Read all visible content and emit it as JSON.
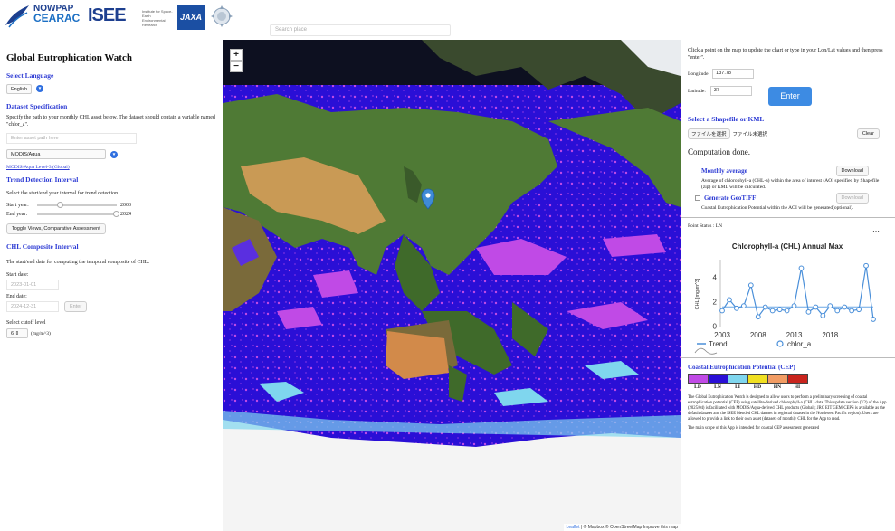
{
  "header": {
    "nowpap_line1": "NOWPAP",
    "nowpap_line2": "CEARAC",
    "isee_logo": "ISEE",
    "isee_sub": "Institute for Space-Earth Environmental Research",
    "jaxa_logo": "JAXA",
    "search_placeholder": "Search place"
  },
  "left_panel": {
    "title": "Global Eutrophication Watch",
    "select_language_heading": "Select Language",
    "language_value": "English",
    "dataset_heading": "Dataset Specification",
    "dataset_text": "Specify the path to your monthly CHL asset below. The dataset should contain a variable named \"chlor_a\".",
    "asset_placeholder": "Enter asset path here",
    "sensor_value": "MODIS/Aqua",
    "sensor_link": "MODIS/Aqua Level-3 (Global)",
    "trend_heading": "Trend Detection Interval",
    "trend_text": "Select the start/end year interval for trend detection.",
    "start_year_label": "Start year:",
    "start_year_value": "2003",
    "end_year_label": "End year:",
    "end_year_value": "2024",
    "toggle_button": "Toggle Views, Comparative Assessment",
    "composite_heading": "CHL Composite Interval",
    "composite_text": "The start/end date for computing the temporal composite of CHL.",
    "start_date_label": "Start date:",
    "start_date_value": "2023-01-01",
    "end_date_label": "End date:",
    "end_date_value": "2024-12-31",
    "enter_small": "Enter",
    "cutoff_label": "Select cutoff level",
    "cutoff_value": "6",
    "cutoff_unit": "(mg/m^3)"
  },
  "map": {
    "zoom_in": "+",
    "zoom_out": "−",
    "attribution_leaflet": "Leaflet",
    "attribution_rest": " | © Mapbox © OpenStreetMap Improve this map",
    "colors": {
      "ocean_ln": "#2a0fd6",
      "ld": "#c04ae6",
      "li": "#7fd6ee",
      "land": "#4f7a35",
      "desert": "#c99a55",
      "ice": "#f4f4f4"
    }
  },
  "right_panel": {
    "instruction": "Click a point on the map to update the chart or type in your Lon/Lat values and then press \"enter\".",
    "longitude_label": "Longitude:",
    "longitude_value": "137.78",
    "latitude_label": "Latitude:",
    "latitude_value": "37",
    "enter_button": "Enter",
    "shapefile_heading": "Select a Shapefile or KML",
    "file_button": "ファイルを選択",
    "file_status": "ファイル未選択",
    "clear_button": "Clear",
    "computation_status": "Computation done.",
    "monthly_avg_label": "Monthly average",
    "download_button": "Download",
    "monthly_avg_text": "Average of chlorophyll-a (CHL-a) within the area of interest (AOI specified by Shapefile (zip) or KML will be calculated.",
    "geotiff_label": "Generate GeoTIFF",
    "geotiff_download": "Download",
    "geotiff_text": "Coastal Eutrophication Potential within the AOI will be generated(optional).",
    "point_status": "Point Status : LN",
    "chart_menu": "⋯",
    "cep_heading": "Coastal Eutrophication Potential (CEP)",
    "cep_legend": [
      {
        "code": "LD",
        "color": "#c04ae6"
      },
      {
        "code": "LN",
        "color": "#2a0fd6"
      },
      {
        "code": "LI",
        "color": "#7fd6ee"
      },
      {
        "code": "HD",
        "color": "#f1e021"
      },
      {
        "code": "HN",
        "color": "#f29c63"
      },
      {
        "code": "HI",
        "color": "#c9241d"
      }
    ],
    "about_text": "The Global Eutrophication Watch is designed to allow users to perform a preliminary screening of coastal eutrophication potential (CEP) using satellite-derived chlorophyll-a (CHL) data. This update version (V2) of the App (2025/04) is facilitated with MODIS/Aqua-derived CHL products (Global); JRC EIT GEM-CEPS is available as the default dataset and the ISEE blended CHL dataset in regional dataset in the Northwest Pacific region). Users are allowed to provide a link to their own asset (dataset) of monthly CHL for the App to read.",
    "footer_text": "The main scope of this App is intended for coastal CEP assessment generated"
  },
  "chart_data": {
    "type": "line",
    "title": "Chlorophyll-a (CHL) Annual Max",
    "ylabel": "CHL [mg/m^3]",
    "xlabel": "",
    "x": [
      2003,
      2004,
      2005,
      2006,
      2007,
      2008,
      2009,
      2010,
      2011,
      2012,
      2013,
      2014,
      2015,
      2016,
      2017,
      2018,
      2019,
      2020,
      2021,
      2022,
      2023,
      2024
    ],
    "xticks": [
      2003,
      2008,
      2013,
      2018
    ],
    "xlim": [
      2003,
      2024
    ],
    "yticks": [
      0,
      2,
      4
    ],
    "ylim": [
      0,
      5.5
    ],
    "series": [
      {
        "name": "chlor_a",
        "values": [
          1.3,
          2.2,
          1.5,
          1.7,
          3.4,
          0.8,
          1.6,
          1.3,
          1.4,
          1.3,
          1.7,
          4.8,
          1.2,
          1.6,
          0.9,
          1.7,
          1.3,
          1.6,
          1.3,
          1.4,
          5.0,
          0.6
        ]
      },
      {
        "name": "Trend",
        "values": [
          1.62,
          1.62
        ]
      }
    ],
    "grid": false,
    "legend": "bottom"
  }
}
